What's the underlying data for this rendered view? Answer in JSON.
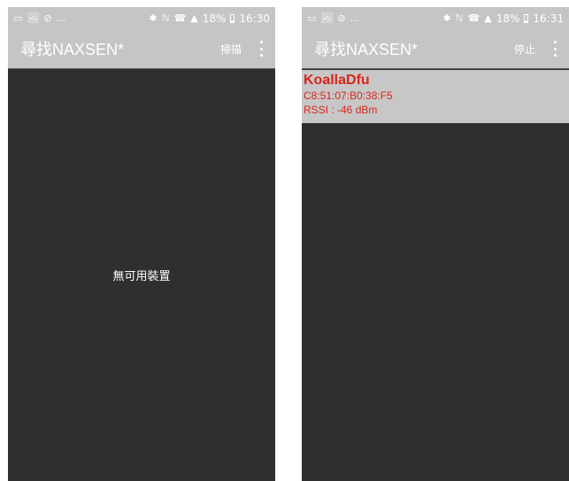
{
  "screens": [
    {
      "status": {
        "left_icons": [
          "▭",
          "🖼",
          "⊘",
          "..."
        ],
        "right_text": "✱ ℕ ☎ ▲ 18% ",
        "battery": "18%",
        "time": "16:30"
      },
      "appbar": {
        "title": "尋找NAXSEN*",
        "action_label": "掃描"
      },
      "empty_text": "無可用裝置"
    },
    {
      "status": {
        "left_icons": [
          "▭",
          "🖼",
          "⊘",
          "..."
        ],
        "right_text": "✱ ℕ ☎ ▲ 18% ",
        "battery": "18%",
        "time": "16:31"
      },
      "appbar": {
        "title": "尋找NAXSEN*",
        "action_label": "停止"
      },
      "devices": [
        {
          "name": "KoallaDfu",
          "address": "C8:51:07:B0:38:F5",
          "rssi": "RSSI : -46 dBm"
        }
      ]
    }
  ],
  "colors": {
    "bar": "#c5c5c5",
    "content_bg": "#2f2f2f",
    "device_text": "#d8261c",
    "device_bg": "#c7c7c7"
  }
}
